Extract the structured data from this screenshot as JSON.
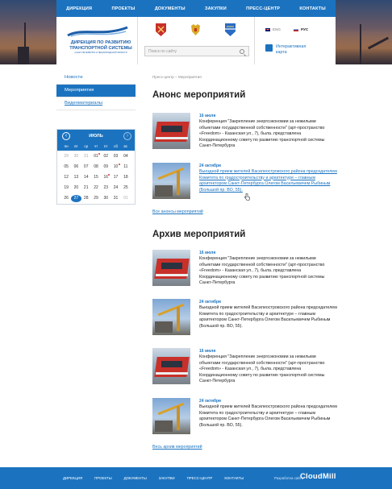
{
  "nav": [
    "ДИРЕКЦИЯ",
    "ПРОЕКТЫ",
    "ДОКУМЕНТЫ",
    "ЗАКУПКИ",
    "ПРЕСС-ЦЕНТР",
    "КОНТАКТЫ"
  ],
  "logo": {
    "line1": "ДИРЕКЦИЯ ПО РАЗВИТИЮ",
    "line2": "ТРАНСПОРТНОЙ СИСТЕМЫ",
    "line3": "САНКТ-ПЕТЕРБУРГА И ЛЕНИНГРАДСКОЙ ОБЛАСТИ"
  },
  "search": {
    "placeholder": "Поиск по сайту"
  },
  "langs": {
    "en": "ENG",
    "ru": "РУС"
  },
  "map_link": {
    "line1": "Интерактивная",
    "line2": "карта"
  },
  "sidebar": {
    "items": [
      {
        "label": "Новости"
      },
      {
        "label": "Мероприятия"
      },
      {
        "label": "Видеоматериалы"
      }
    ]
  },
  "calendar": {
    "month": "ИЮЛЬ",
    "weekdays": [
      "пн",
      "вт",
      "ср",
      "чт",
      "пт",
      "сб",
      "вс"
    ],
    "cells": [
      "29",
      "30",
      "31",
      "01",
      "02",
      "03",
      "04",
      "05",
      "06",
      "07",
      "08",
      "09",
      "10",
      "11",
      "12",
      "13",
      "14",
      "15",
      "16",
      "17",
      "18",
      "19",
      "20",
      "21",
      "22",
      "23",
      "24",
      "25",
      "26",
      "27",
      "28",
      "29",
      "30",
      "31",
      "01"
    ]
  },
  "breadcrumb": "Пресс-центр – Мероприятия",
  "announce_title": "Анонс мероприятий",
  "archive_title": "Архив мероприятий",
  "events": {
    "e1": {
      "date": "16 июля",
      "text": "Конференция \"Закрепление энергоэкономии за нежилыми объектами государственной собственности\" (арт-пространство «Freedom» - Казанская ул., 7), была..представлена Координационному совету по развитию транспортной системы Санкт-Петербурга"
    },
    "e2": {
      "date": "24 октября",
      "text": "Выездной прием жителей Василеостровского района председателем Комитета по градостроительству и архитектуре – главным архитектором Санкт-Петербурга Олегом Васильевичем Рыбиным (Большой пр. ВО, 55)."
    },
    "e3": {
      "date": "16 июля",
      "text": "Конференция \"Закрепление энергоэкономии за нежилыми объектами государственной собственности\" (арт-пространство «Freedom» - Казанская ул., 7), была..представлена Координационному совету по развитию транспортной системы Санкт-Петербурга"
    },
    "e4": {
      "date": "24 октября",
      "text": "Выездной прием жителей Василеостровского района председателем Комитета по градостроительству и архитектуре – главным архитектором Санкт-Петербурга Олегом Васильевичем Рыбиным (Большой пр. ВО, 55)."
    },
    "e5": {
      "date": "16 июля",
      "text": "Конференция \"Закрепление энергоэкономии за нежилыми объектами государственной собственности\" (арт-пространство «Freedom» - Казанская ул., 7), была..представлена Координационному совету по развитию транспортной системы Санкт-Петербурга"
    },
    "e6": {
      "date": "24 октября",
      "text": "Выездной прием жителей Василеостровского района председателем Комитета по градостроительству и архитектуре – главным архитектором Санкт-Петербурга Олегом Васильевичем Рыбиным (Большой пр. ВО, 55)."
    }
  },
  "all_announce": "Все анонсы мероприятий",
  "all_archive": "Весь архив мероприятий",
  "footer": {
    "nav": [
      "ДИРЕКЦИЯ",
      "ПРОЕКТЫ",
      "ДОКУМЕНТЫ",
      "ЗАКУПКИ",
      "ПРЕСС-ЦЕНТР",
      "КОНТАКТЫ"
    ],
    "dev": "Разработка сайта",
    "brand": "CloudMill"
  },
  "colors": {
    "accent": "#1b73c0"
  }
}
